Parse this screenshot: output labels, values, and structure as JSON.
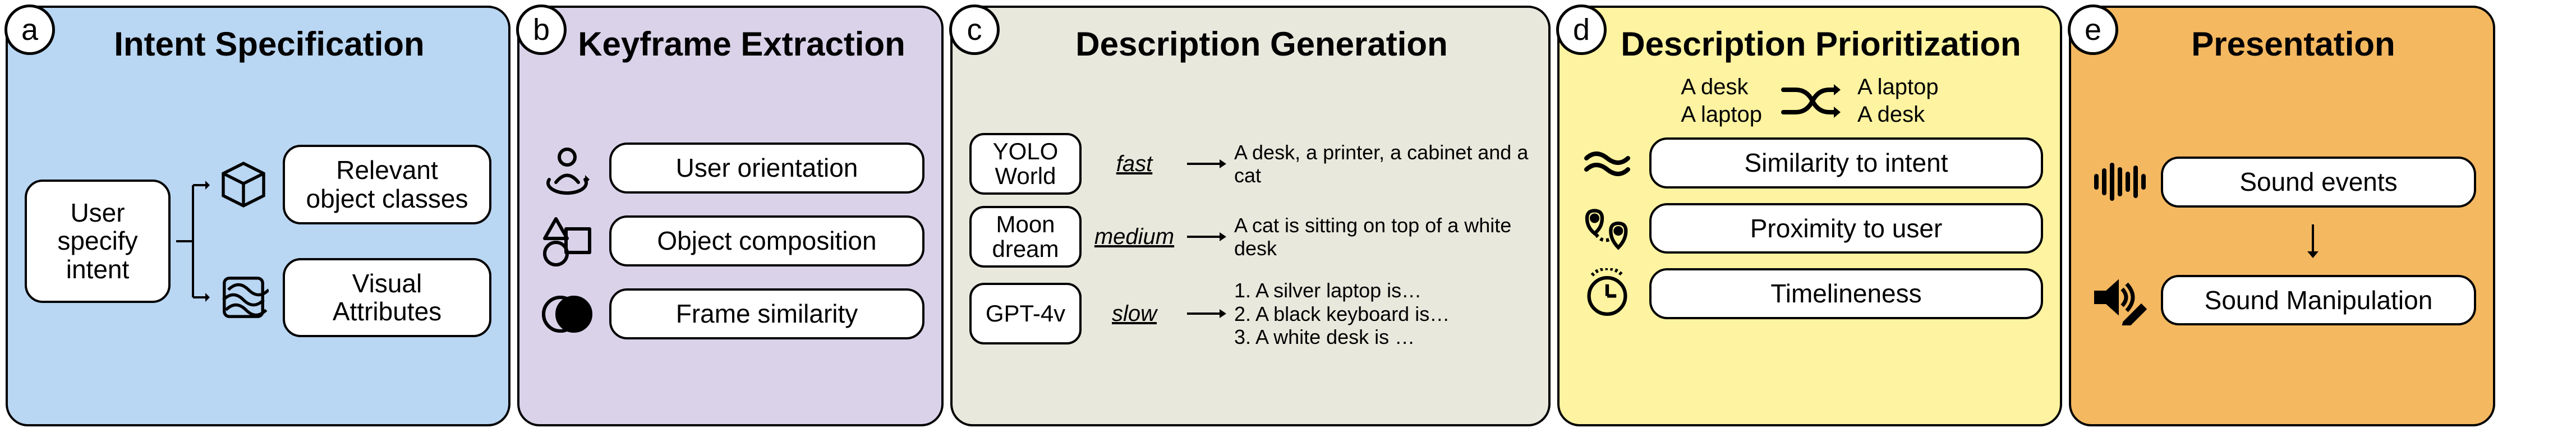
{
  "panels": {
    "a": {
      "badge": "a",
      "title": "Intent Specification",
      "user_box": "User specify intent",
      "out1": "Relevant object classes",
      "out2": "Visual Attributes"
    },
    "b": {
      "badge": "b",
      "title": "Keyframe Extraction",
      "items": [
        "User orientation",
        "Object composition",
        "Frame similarity"
      ]
    },
    "c": {
      "badge": "c",
      "title": "Description Generation",
      "rows": [
        {
          "model": "YOLO World",
          "speed": "fast",
          "output": "A desk, a printer, a cabinet and a cat"
        },
        {
          "model": "Moon dream",
          "speed": "medium",
          "output": "A cat is sitting on top of a white desk"
        },
        {
          "model": "GPT-4v",
          "speed": "slow",
          "output": "1. A silver laptop is…\n2. A black keyboard is…\n3. A white desk is …"
        }
      ]
    },
    "d": {
      "badge": "d",
      "title": "Description Prioritization",
      "before": [
        "A desk",
        "A laptop"
      ],
      "after": [
        "A laptop",
        "A desk"
      ],
      "items": [
        "Similarity to intent",
        "Proximity to user",
        "Timelineness"
      ]
    },
    "e": {
      "badge": "e",
      "title": "Presentation",
      "item1": "Sound events",
      "item2": "Sound Manipulation"
    }
  }
}
